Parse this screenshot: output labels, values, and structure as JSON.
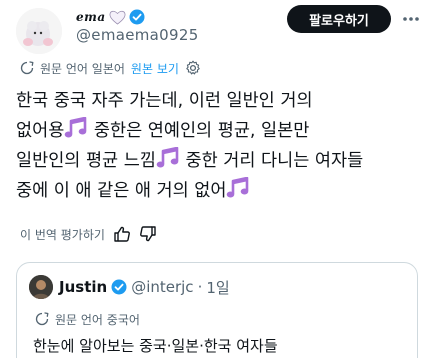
{
  "tweet": {
    "author": {
      "display_name": "ema",
      "handle": "@emaema0925",
      "verified": true
    },
    "follow_label": "팔로우하기",
    "translate": {
      "label": "원문 언어 일본어",
      "link": "원본 보기"
    },
    "text_lines": [
      "한국 중국 자주 가는데, 이런 일반인 거의",
      "없어용",
      "중한은 연예인의 평균, 일본만",
      "일반인의 평균 느낌",
      "중한 거리 다니는 여자들",
      "중에 이 애 같은 애 거의 없어"
    ],
    "rate_label": "이 번역 평가하기",
    "colors": {
      "accent": "#1d9bf0",
      "note": "#a86fd8",
      "text": "#0f1419",
      "muted": "#536471"
    }
  },
  "quote": {
    "author": {
      "display_name": "Justin",
      "handle": "@interjc",
      "time": "1일",
      "verified": true
    },
    "translate_label": "원문 언어 중국어",
    "text": "한눈에 알아보는 중국·일본·한국 여자들"
  }
}
